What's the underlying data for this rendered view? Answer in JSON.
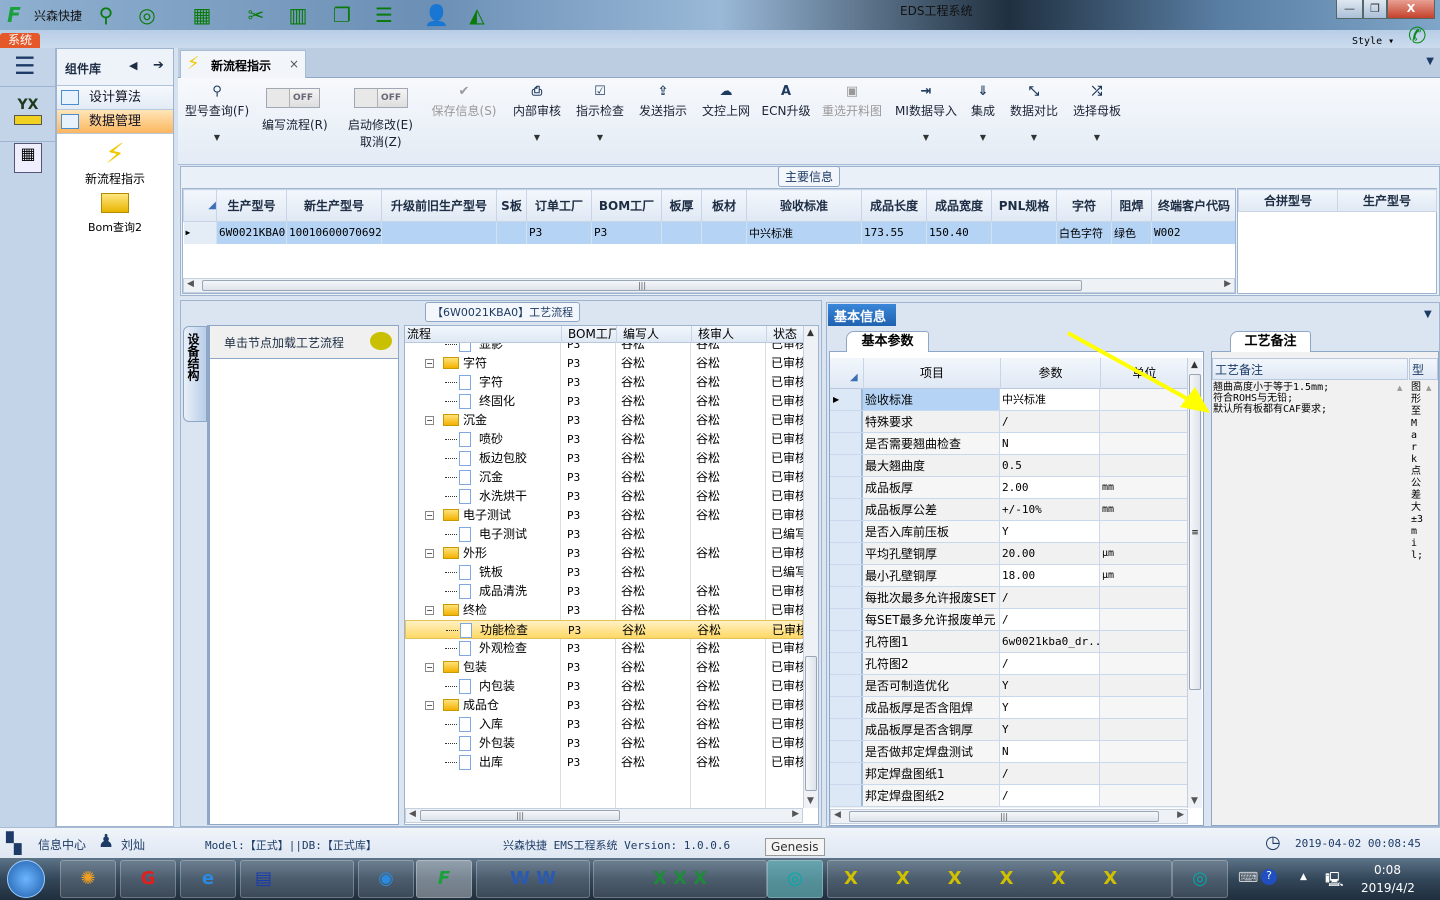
{
  "window": {
    "app_name": "兴森快捷",
    "title": "EDS工程系统",
    "minimize": "—",
    "restore": "❐",
    "close": "X"
  },
  "quickbar": {
    "icons": [
      "search-icon",
      "lifebuoy-icon",
      "grid-icon",
      "scissors-icon",
      "film-icon",
      "copy-icon",
      "list-icon",
      "user-icon",
      "area-chart-icon"
    ]
  },
  "ribbon_tabs": {
    "system": "系统",
    "style": "Style ▾"
  },
  "component_panel": {
    "title": "组件库",
    "items": [
      {
        "label": "设计算法"
      },
      {
        "label": "数据管理",
        "selected": true
      }
    ],
    "tools": [
      {
        "label": "新流程指示",
        "icon": "lightning-icon"
      },
      {
        "label": "Bom查询2",
        "icon": "folder-open-icon"
      }
    ]
  },
  "doc_tab": {
    "label": "新流程指示",
    "close": "×"
  },
  "toolbar": {
    "find": {
      "label": "型号查询(F)"
    },
    "toggle1": {
      "state": "OFF",
      "label": "编写流程(R)"
    },
    "toggle2": {
      "state": "OFF",
      "label": "启动修改(E)",
      "label2": "取消(Z)"
    },
    "buttons": [
      {
        "label": "保存信息(S)",
        "icon": "✔",
        "disabled": true
      },
      {
        "label": "内部审核",
        "icon": "⎙",
        "dropdown": true
      },
      {
        "label": "指示检查",
        "icon": "☑",
        "dropdown": true
      },
      {
        "label": "发送指示",
        "icon": "⇪"
      },
      {
        "label": "文控上网",
        "icon": "☁"
      },
      {
        "label": "ECN升级",
        "icon": "A"
      },
      {
        "label": "重选开料图",
        "icon": "▣",
        "disabled": true
      },
      {
        "label": "MI数据导入",
        "icon": "⇥",
        "dropdown": true
      },
      {
        "label": "集成",
        "icon": "⇓",
        "dropdown": true
      },
      {
        "label": "数据对比",
        "icon": "⤡",
        "dropdown": true
      },
      {
        "label": "选择母板",
        "icon": "⤮",
        "dropdown": true
      }
    ]
  },
  "main_info": {
    "label": "主要信息",
    "columns": [
      "生产型号",
      "新生产型号",
      "升级前旧生产型号",
      "S板",
      "订单工厂",
      "BOM工厂",
      "板厚",
      "板材",
      "验收标准",
      "成品长度",
      "成品宽度",
      "PNL规格",
      "字符",
      "阻焊",
      "终端客户代码"
    ],
    "rows": [
      [
        "6W0021KBA0",
        "10010600070692",
        "",
        "",
        "P3",
        "P3",
        "",
        "",
        "中兴标准",
        "173.55",
        "150.40",
        "",
        "白色字符",
        "绿色",
        "W002"
      ]
    ],
    "side_columns": [
      "合拼型号",
      "生产型号"
    ]
  },
  "process": {
    "title": "【6W0021KBA0】工艺流程",
    "side_tab": "设备结构",
    "hint": "单击节点加载工艺流程",
    "columns": [
      "流程",
      "BOM工厂",
      "编写人",
      "核审人",
      "状态"
    ],
    "rows": [
      {
        "name": "显影",
        "folder": false,
        "bom": "P3",
        "writer": "谷松",
        "reviewer": "谷松",
        "status": "已审核"
      },
      {
        "name": "字符",
        "folder": true,
        "bom": "P3",
        "writer": "谷松",
        "reviewer": "谷松",
        "status": "已审核"
      },
      {
        "name": "字符",
        "folder": false,
        "bom": "P3",
        "writer": "谷松",
        "reviewer": "谷松",
        "status": "已审核"
      },
      {
        "name": "终固化",
        "folder": false,
        "bom": "P3",
        "writer": "谷松",
        "reviewer": "谷松",
        "status": "已审核"
      },
      {
        "name": "沉金",
        "folder": true,
        "bom": "P3",
        "writer": "谷松",
        "reviewer": "谷松",
        "status": "已审核"
      },
      {
        "name": "喷砂",
        "folder": false,
        "bom": "P3",
        "writer": "谷松",
        "reviewer": "谷松",
        "status": "已审核"
      },
      {
        "name": "板边包胶",
        "folder": false,
        "bom": "P3",
        "writer": "谷松",
        "reviewer": "谷松",
        "status": "已审核"
      },
      {
        "name": "沉金",
        "folder": false,
        "bom": "P3",
        "writer": "谷松",
        "reviewer": "谷松",
        "status": "已审核"
      },
      {
        "name": "水洗烘干",
        "folder": false,
        "bom": "P3",
        "writer": "谷松",
        "reviewer": "谷松",
        "status": "已审核"
      },
      {
        "name": "电子测试",
        "folder": true,
        "bom": "P3",
        "writer": "谷松",
        "reviewer": "谷松",
        "status": "已审核"
      },
      {
        "name": "电子测试",
        "folder": false,
        "bom": "P3",
        "writer": "谷松",
        "reviewer": "",
        "status": "已编写"
      },
      {
        "name": "外形",
        "folder": true,
        "bom": "P3",
        "writer": "谷松",
        "reviewer": "谷松",
        "status": "已审核"
      },
      {
        "name": "铣板",
        "folder": false,
        "bom": "P3",
        "writer": "谷松",
        "reviewer": "",
        "status": "已编写"
      },
      {
        "name": "成品清洗",
        "folder": false,
        "bom": "P3",
        "writer": "谷松",
        "reviewer": "谷松",
        "status": "已审核"
      },
      {
        "name": "终检",
        "folder": true,
        "bom": "P3",
        "writer": "谷松",
        "reviewer": "谷松",
        "status": "已审核"
      },
      {
        "name": "功能检查",
        "folder": false,
        "bom": "P3",
        "writer": "谷松",
        "reviewer": "谷松",
        "status": "已审核",
        "selected": true
      },
      {
        "name": "外观检查",
        "folder": false,
        "bom": "P3",
        "writer": "谷松",
        "reviewer": "谷松",
        "status": "已审核"
      },
      {
        "name": "包装",
        "folder": true,
        "bom": "P3",
        "writer": "谷松",
        "reviewer": "谷松",
        "status": "已审核"
      },
      {
        "name": "内包装",
        "folder": false,
        "bom": "P3",
        "writer": "谷松",
        "reviewer": "谷松",
        "status": "已审核"
      },
      {
        "name": "成品仓",
        "folder": true,
        "bom": "P3",
        "writer": "谷松",
        "reviewer": "谷松",
        "status": "已审核"
      },
      {
        "name": "入库",
        "folder": false,
        "bom": "P3",
        "writer": "谷松",
        "reviewer": "谷松",
        "status": "已审核"
      },
      {
        "name": "外包装",
        "folder": false,
        "bom": "P3",
        "writer": "谷松",
        "reviewer": "谷松",
        "status": "已审核"
      },
      {
        "name": "出库",
        "folder": false,
        "bom": "P3",
        "writer": "谷松",
        "reviewer": "谷松",
        "status": "已审核"
      }
    ]
  },
  "basic_info": {
    "panel_tab": "基本信息",
    "tab": "基本参数",
    "columns": [
      "项目",
      "参数",
      "单位"
    ],
    "rows": [
      [
        "验收标准",
        "中兴标准",
        ""
      ],
      [
        "特殊要求",
        "/",
        ""
      ],
      [
        "是否需要翘曲检查",
        "N",
        ""
      ],
      [
        "最大翘曲度",
        "0.5",
        ""
      ],
      [
        "成品板厚",
        "2.00",
        "mm"
      ],
      [
        "成品板厚公差",
        "+/-10%",
        "mm"
      ],
      [
        "是否入库前压板",
        "Y",
        ""
      ],
      [
        "平均孔壁铜厚",
        "20.00",
        "μm"
      ],
      [
        "最小孔壁铜厚",
        "18.00",
        "μm"
      ],
      [
        "每批次最多允许报废SET",
        "/",
        ""
      ],
      [
        "每SET最多允许报废单元",
        "/",
        ""
      ],
      [
        "孔符图1",
        "6w0021kba0_dr...",
        ""
      ],
      [
        "孔符图2",
        "/",
        ""
      ],
      [
        "是否可制造优化",
        "Y",
        ""
      ],
      [
        "成品板厚是否含阻焊",
        "Y",
        ""
      ],
      [
        "成品板厚是否含铜厚",
        "Y",
        ""
      ],
      [
        "是否做邦定焊盘测试",
        "N",
        ""
      ],
      [
        "邦定焊盘图纸1",
        "/",
        ""
      ],
      [
        "邦定焊盘图纸2",
        "/",
        ""
      ]
    ]
  },
  "remarks": {
    "tab": "工艺备注",
    "col1": "工艺备注",
    "col2": "型",
    "text": "翘曲高度小于等于1.5mm;\n符合ROHS与无铅;\n默认所有板都有CAF要求;",
    "col2_text": "图形至Mark点公差大±3mil;"
  },
  "statusbar": {
    "info_center": "信息中心",
    "user": "刘灿",
    "model": "Model:【正式】||DB:【正式库】",
    "version": "兴森快捷 EMS工程系统 Version: 1.0.0.6",
    "datetime": "2019-04-02 00:08:45",
    "tooltip": "Genesis"
  },
  "taskbar": {
    "time": "0:08",
    "date": "2019/4/2"
  },
  "colors": {
    "accent": "#1f6fc6",
    "system_tab": "#e5582a",
    "selected_row": "#ffd863",
    "arrow": "#ffff00"
  }
}
